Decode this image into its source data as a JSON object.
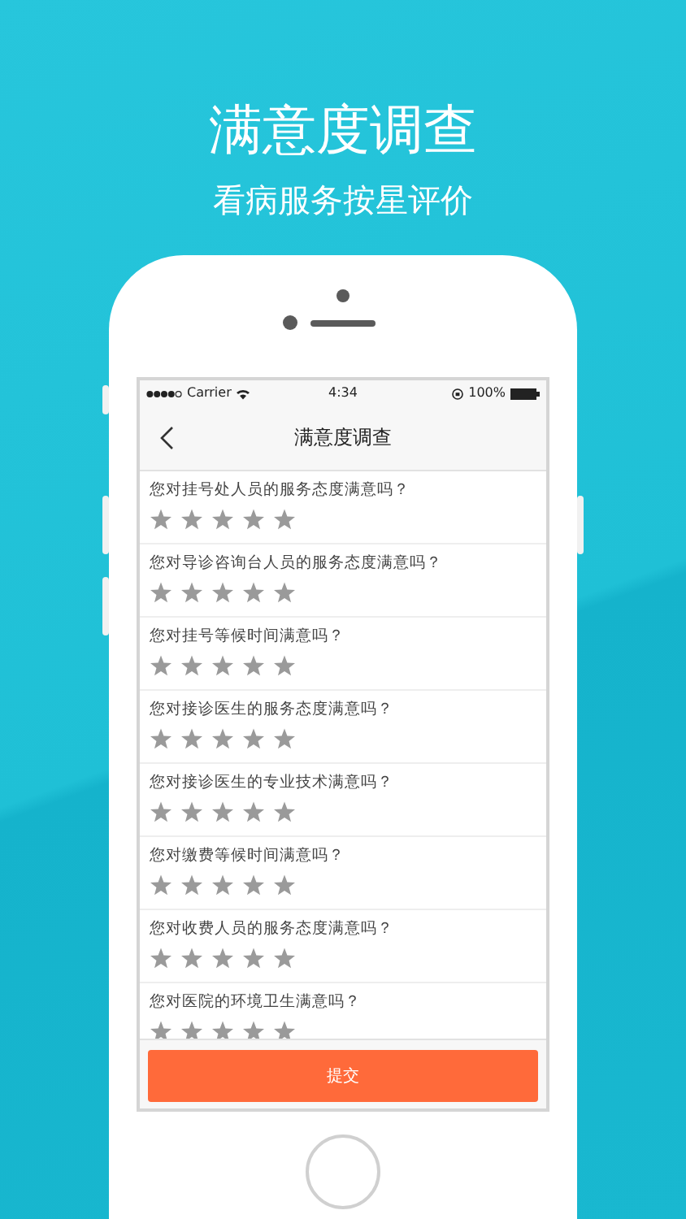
{
  "headline": "满意度调查",
  "subheadline": "看病服务按星评价",
  "status_bar": {
    "carrier": "Carrier",
    "time": "4:34",
    "battery": "100%"
  },
  "nav": {
    "title": "满意度调查"
  },
  "questions": [
    {
      "text": "您对挂号处人员的服务态度满意吗？"
    },
    {
      "text": "您对导诊咨询台人员的服务态度满意吗？"
    },
    {
      "text": "您对挂号等候时间满意吗？"
    },
    {
      "text": "您对接诊医生的服务态度满意吗？"
    },
    {
      "text": "您对接诊医生的专业技术满意吗？"
    },
    {
      "text": "您对缴费等候时间满意吗？"
    },
    {
      "text": "您对收费人员的服务态度满意吗？"
    },
    {
      "text": "您对医院的环境卫生满意吗？"
    }
  ],
  "submit": "提交"
}
